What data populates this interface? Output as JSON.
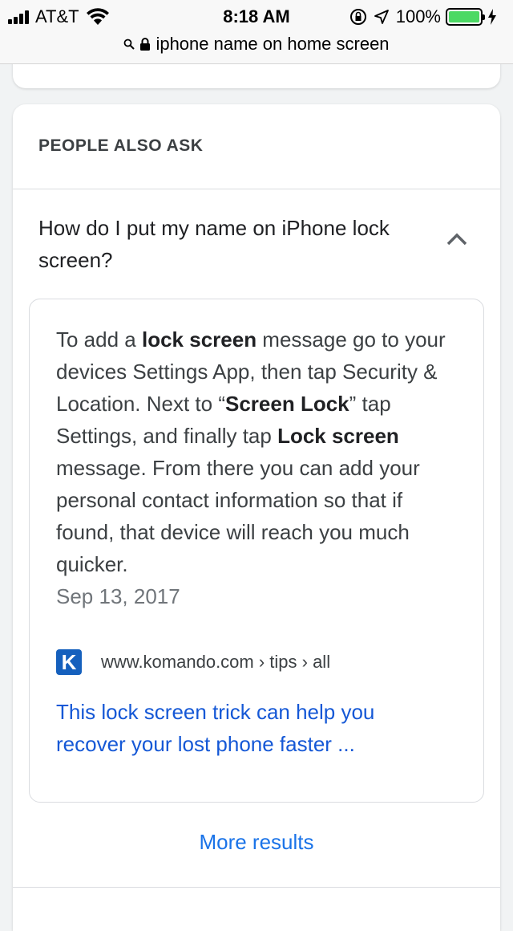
{
  "status_bar": {
    "carrier": "AT&T",
    "time": "8:18 AM",
    "battery_percent": "100%",
    "battery_level": 1.0,
    "battery_color": "#4cd964"
  },
  "url_bar": {
    "query": "iphone name on home screen",
    "icons": [
      "search-icon",
      "lock-icon"
    ]
  },
  "people_also_ask": {
    "title": "PEOPLE ALSO ASK",
    "question": "How do I put my name on iPhone lock screen?",
    "answer": {
      "parts": [
        {
          "text": "To add a ",
          "bold": false
        },
        {
          "text": "lock screen",
          "bold": true
        },
        {
          "text": " message go to your devices Settings App, then tap Security & Location. Next to “",
          "bold": false
        },
        {
          "text": "Screen Lock",
          "bold": true
        },
        {
          "text": "” tap Settings, and finally tap ",
          "bold": false
        },
        {
          "text": "Lock screen",
          "bold": true
        },
        {
          "text": " message. From there you can add your personal contact information so that if found, that device will reach you much quicker.",
          "bold": false
        }
      ],
      "date": "Sep 13, 2017"
    },
    "source": {
      "favicon_letter": "K",
      "url": "www.komando.com › tips › all",
      "link_text": "This lock screen trick can help you recover your lost phone faster ..."
    },
    "more_results": "More results"
  },
  "colors": {
    "link": "#1558d6",
    "more_results": "#1a73e8",
    "favicon_bg": "#1560bd"
  }
}
